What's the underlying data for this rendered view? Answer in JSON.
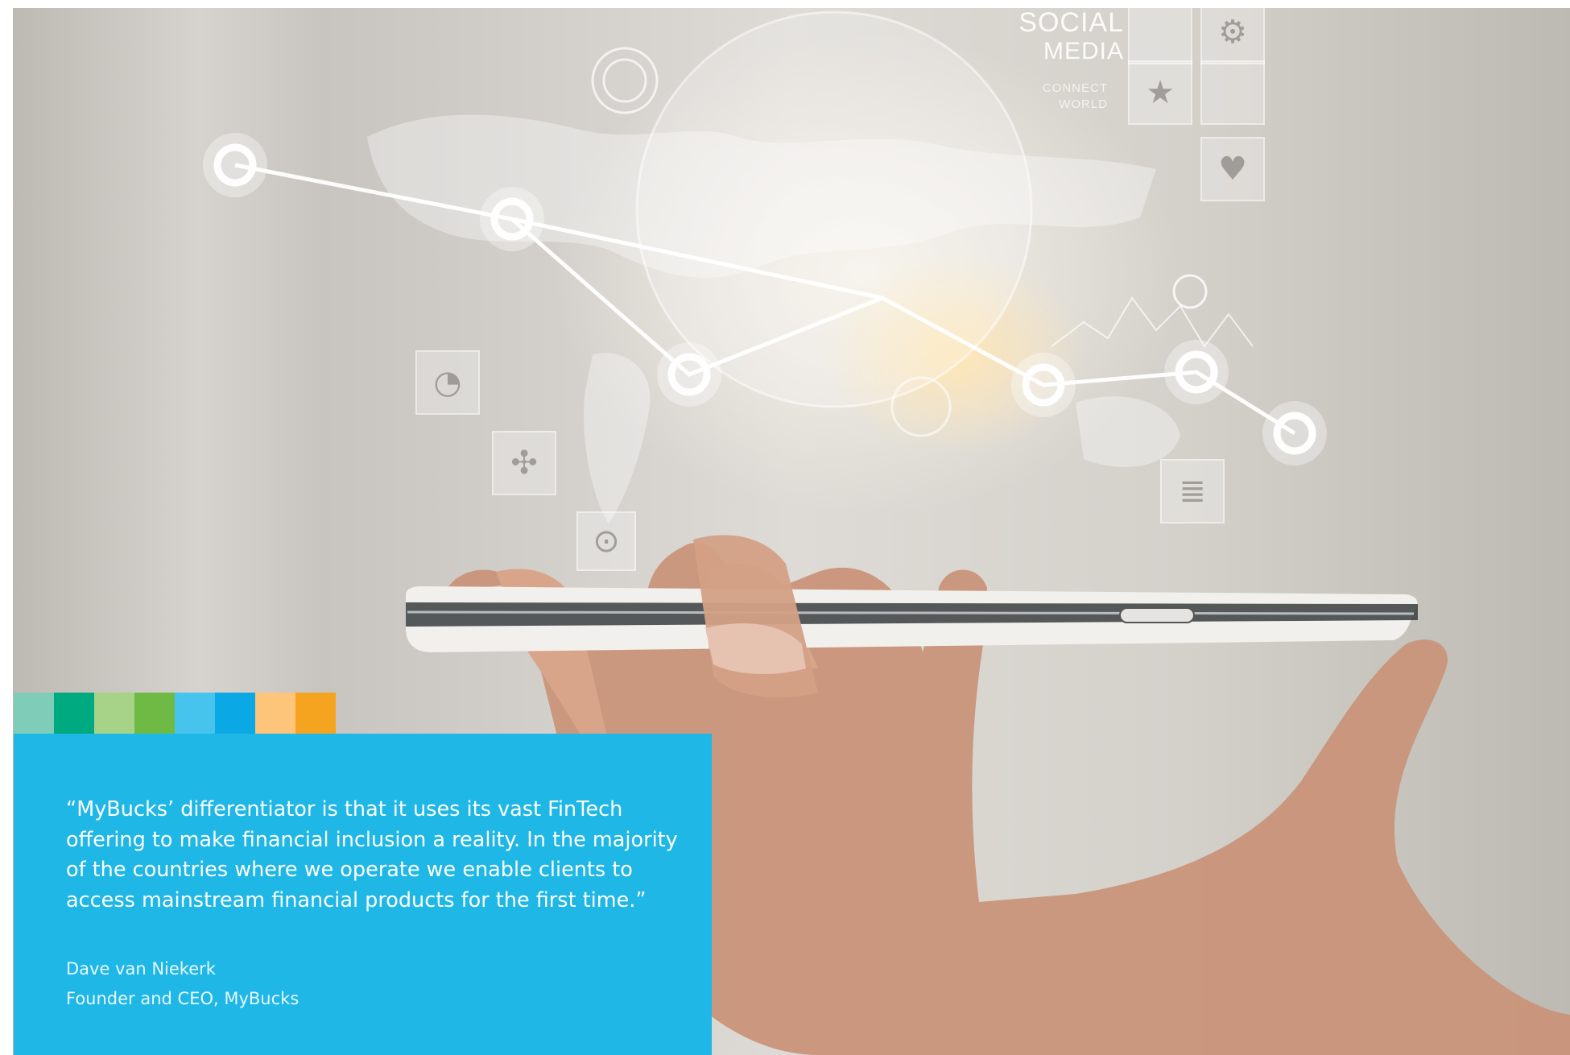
{
  "background": {
    "overlay_heading": "SOCIAL",
    "overlay_heading_2": "MEDIA",
    "overlay_subtext": "CONNECT\nWORLD",
    "tile_icons": [
      "star-icon",
      "heart-icon",
      "gear-icon",
      "document-icon",
      "pie-chart-icon",
      "puzzle-icon",
      "download-icon"
    ]
  },
  "swatches": [
    "#7fcdb8",
    "#00aa80",
    "#a7d388",
    "#6fba45",
    "#47c4ee",
    "#0aa8e4",
    "#fcc57a",
    "#f4a41f"
  ],
  "quote": {
    "text": "“MyBucks’ differentiator is that it uses its vast FinTech offering to make financial inclusion a reality. In the majority of the countries where we operate we enable clients to access mainstream financial products for the first time.”",
    "author_name": "Dave van Niekerk",
    "author_title": "Founder and CEO, MyBucks",
    "background_color": "#1eb7e6"
  }
}
